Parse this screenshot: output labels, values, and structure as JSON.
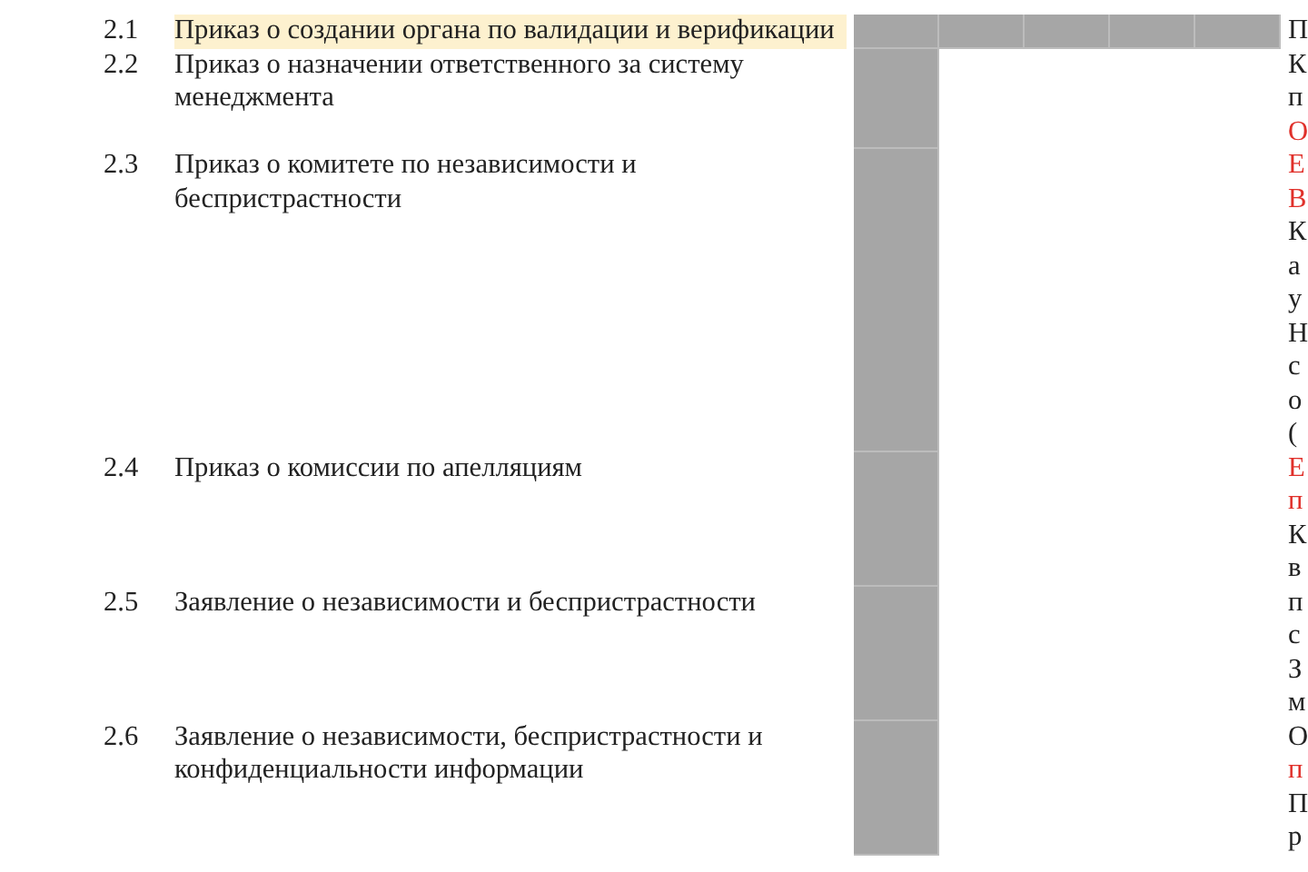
{
  "rows": [
    {
      "number": "2.1",
      "title": "Приказ о создании органа по валидации и верификации",
      "highlighted": true,
      "shaded": [
        true,
        true,
        true,
        true,
        true
      ],
      "notes": [
        {
          "text": "П",
          "red": false
        }
      ]
    },
    {
      "number": "2.2",
      "title": "Приказ о назначении ответственного за систему менеджмента",
      "highlighted": false,
      "shaded": [
        true,
        false,
        false,
        false,
        false
      ],
      "notes": [
        {
          "text": "К",
          "red": false
        },
        {
          "text": "п",
          "red": false
        },
        {
          "text": "О",
          "red": true
        }
      ]
    },
    {
      "number": "2.3",
      "title": "Приказ о комитете по независимости и беспристрастности",
      "highlighted": false,
      "shaded": [
        true,
        false,
        false,
        false,
        false
      ],
      "notes": [
        {
          "text": "Е",
          "red": true
        },
        {
          "text": "В",
          "red": true
        },
        {
          "text": "К",
          "red": false
        },
        {
          "text": "а",
          "red": false
        },
        {
          "text": "у",
          "red": false
        },
        {
          "text": "Н",
          "red": false
        },
        {
          "text": "с",
          "red": false
        },
        {
          "text": "о",
          "red": false
        },
        {
          "text": "(",
          "red": false
        }
      ]
    },
    {
      "number": "2.4",
      "title": "Приказ о комиссии по апелляциям",
      "highlighted": false,
      "shaded": [
        true,
        false,
        false,
        false,
        false
      ],
      "notes": [
        {
          "text": "Е",
          "red": true
        },
        {
          "text": "п",
          "red": true
        },
        {
          "text": "К",
          "red": false
        },
        {
          "text": "в",
          "red": false
        }
      ]
    },
    {
      "number": "2.5",
      "title": "Заявление о независимости и беспристрастности",
      "highlighted": false,
      "shaded": [
        true,
        false,
        false,
        false,
        false
      ],
      "notes": [
        {
          "text": "п",
          "red": false
        },
        {
          "text": "с",
          "red": false
        },
        {
          "text": "З",
          "red": false
        },
        {
          "text": "м",
          "red": false
        }
      ]
    },
    {
      "number": "2.6",
      "title": "Заявление о независимости, беспристрастности и конфиденциальности информации",
      "highlighted": false,
      "shaded": [
        true,
        false,
        false,
        false,
        false
      ],
      "notes": [
        {
          "text": "О",
          "red": false
        },
        {
          "text": "п",
          "red": true
        },
        {
          "text": "П",
          "red": false
        },
        {
          "text": "р",
          "red": false
        }
      ]
    }
  ]
}
